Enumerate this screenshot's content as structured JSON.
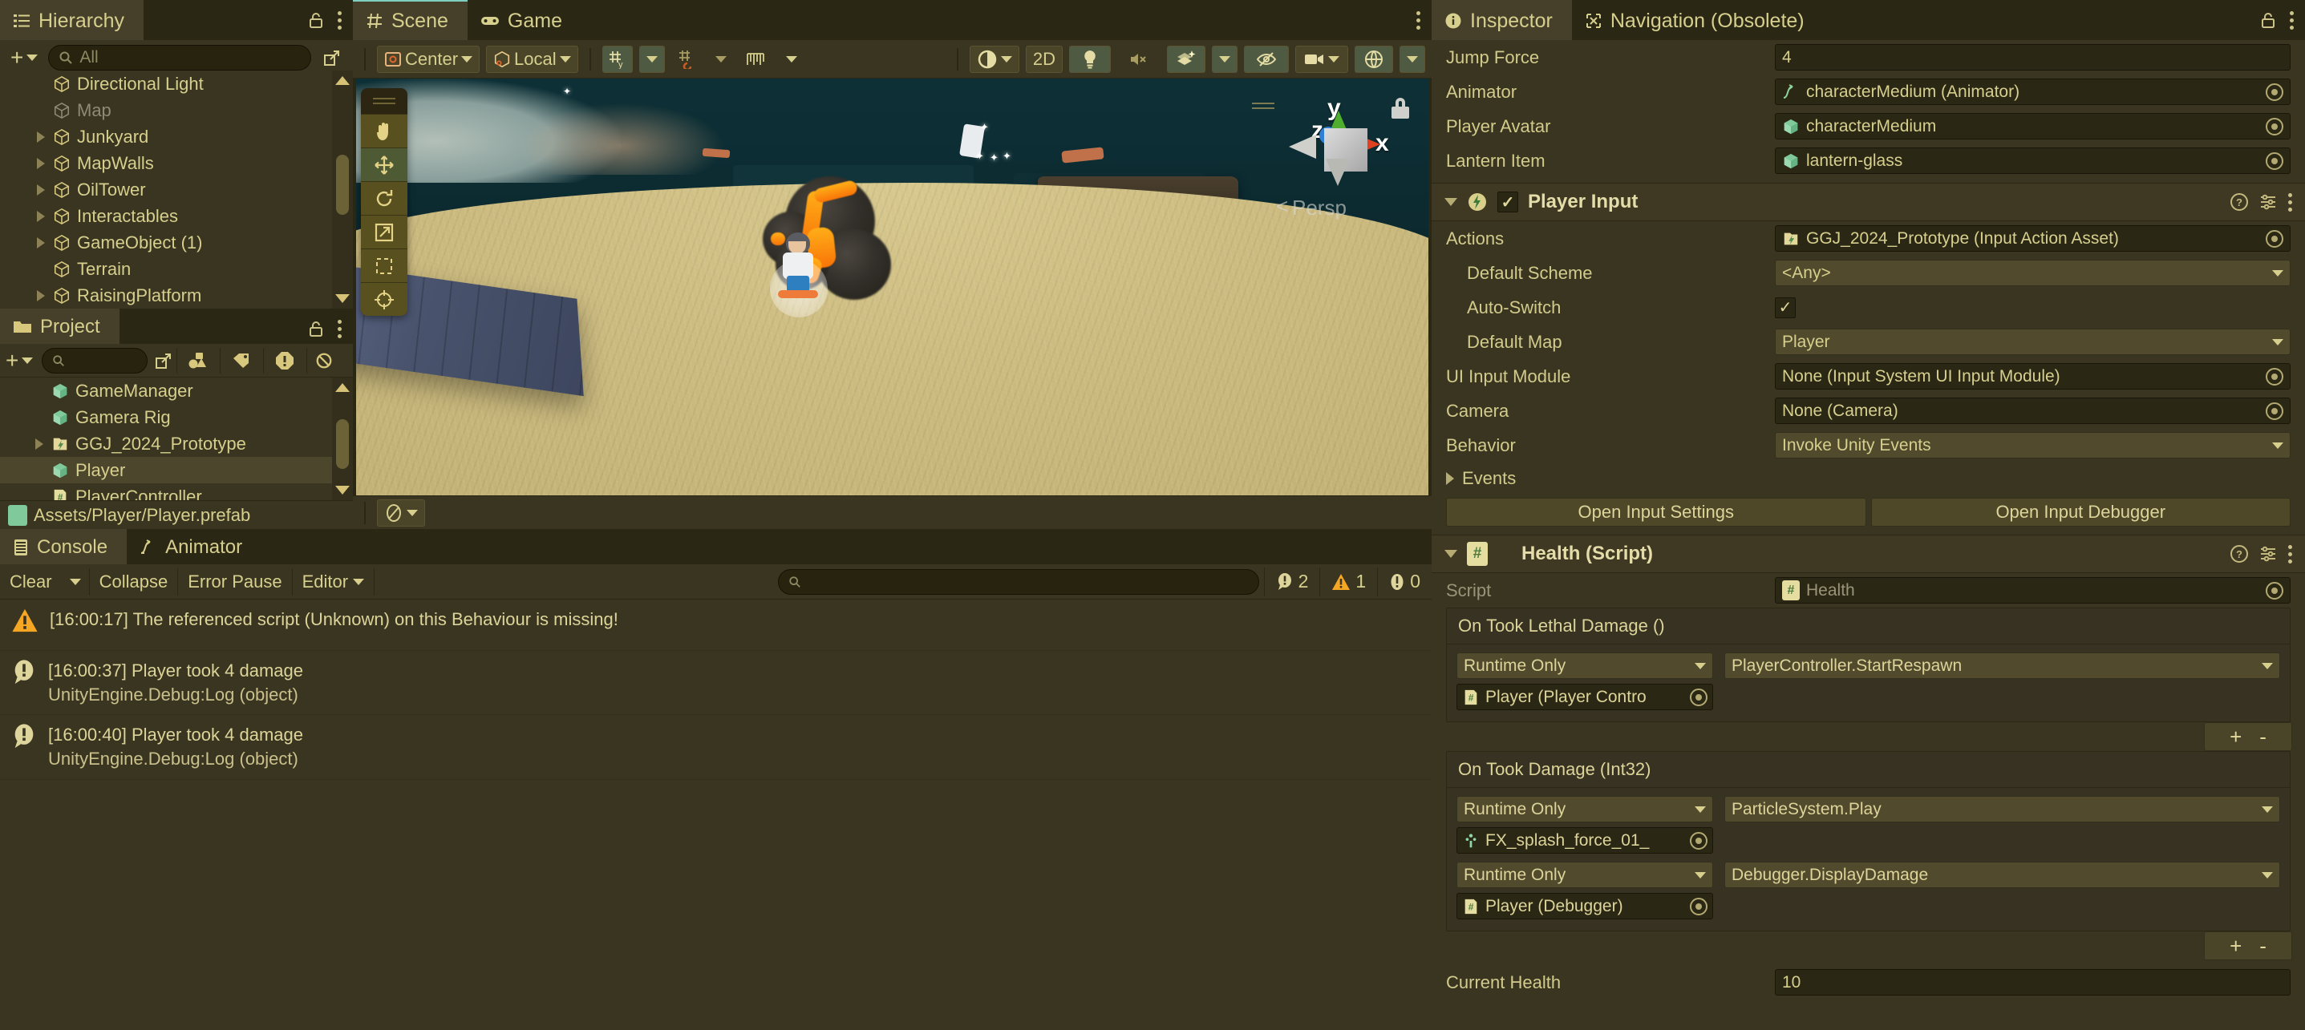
{
  "hierarchy": {
    "tab_label": "Hierarchy",
    "tab_icon": "hierarchy-icon",
    "add_label": "+",
    "search_placeholder": "All",
    "items": [
      {
        "label": "Directional Light",
        "indent": 1,
        "expandable": false,
        "dim": false
      },
      {
        "label": "Map",
        "indent": 1,
        "expandable": false,
        "dim": true
      },
      {
        "label": "Junkyard",
        "indent": 1,
        "expandable": true,
        "dim": false
      },
      {
        "label": "MapWalls",
        "indent": 1,
        "expandable": true,
        "dim": false
      },
      {
        "label": "OilTower",
        "indent": 1,
        "expandable": true,
        "dim": false
      },
      {
        "label": "Interactables",
        "indent": 1,
        "expandable": true,
        "dim": false
      },
      {
        "label": "GameObject (1)",
        "indent": 1,
        "expandable": true,
        "dim": false
      },
      {
        "label": "Terrain",
        "indent": 1,
        "expandable": false,
        "dim": false
      },
      {
        "label": "RaisingPlatform",
        "indent": 1,
        "expandable": true,
        "dim": false
      }
    ]
  },
  "project": {
    "tab_label": "Project",
    "tab_icon": "folder-icon",
    "search_placeholder": "",
    "toolbar_icons": [
      "shapes-icon",
      "tag-icon",
      "warning-octagon-icon",
      "no-sign-icon"
    ],
    "items": [
      {
        "label": "GameManager",
        "icon": "prefab-cube",
        "expandable": false,
        "selected": false
      },
      {
        "label": "Gamera Rig",
        "icon": "prefab-cube",
        "expandable": false,
        "selected": false
      },
      {
        "label": "GGJ_2024_Prototype",
        "icon": "input-asset",
        "expandable": true,
        "selected": false
      },
      {
        "label": "Player",
        "icon": "prefab-cube",
        "expandable": false,
        "selected": true
      },
      {
        "label": "PlayerController",
        "icon": "script-file",
        "expandable": false,
        "selected": false
      }
    ],
    "footer_path": "Assets/Player/Player.prefab"
  },
  "scene": {
    "tabs": [
      {
        "label": "Scene",
        "icon": "grid-icon",
        "active": true
      },
      {
        "label": "Game",
        "icon": "gamepad-icon",
        "active": false
      }
    ],
    "toolbar": {
      "pivot_label": "Center",
      "pivot_icon": "pivot-center-icon",
      "space_label": "Local",
      "space_icon": "local-space-icon",
      "grid_snap_icon": "grid-axis-y-icon",
      "snap_increment_icon": "grid-snap-icon",
      "ruler_icon": "ruler-icon",
      "shading_icon": "shaded-sphere-icon",
      "mode_2d_label": "2D",
      "lighting_icon": "lightbulb-icon",
      "audio_icon": "audio-mute-icon",
      "effects_icon": "fx-sparkle-icon",
      "hidden_icon": "eye-hidden-icon",
      "camera_icon": "camera-icon",
      "gizmos_icon": "gizmos-globe-icon"
    },
    "tools": [
      {
        "name": "hand-tool-icon",
        "active": false
      },
      {
        "name": "move-tool-icon",
        "active": true
      },
      {
        "name": "rotate-tool-icon",
        "active": false
      },
      {
        "name": "scale-tool-icon",
        "active": false
      },
      {
        "name": "rect-tool-icon",
        "active": false
      },
      {
        "name": "transform-tool-icon",
        "active": false
      }
    ],
    "gizmo": {
      "axis_x": "x",
      "axis_y": "y",
      "axis_z": "z",
      "perspective_label": "Persp"
    },
    "bottom_tool_icon": "no-effects-icon"
  },
  "console": {
    "tabs": [
      {
        "label": "Console",
        "icon": "console-icon",
        "active": true
      },
      {
        "label": "Animator",
        "icon": "animator-icon",
        "active": false
      }
    ],
    "toolbar": {
      "clear_label": "Clear",
      "collapse_label": "Collapse",
      "error_pause_label": "Error Pause",
      "editor_label": "Editor",
      "search_placeholder": ""
    },
    "counts": {
      "log": "2",
      "warning": "1",
      "error": "0"
    },
    "logs": [
      {
        "type": "warning",
        "message": "[16:00:17] The referenced script (Unknown) on this Behaviour is missing!",
        "detail": ""
      },
      {
        "type": "info",
        "message": "[16:00:37] Player took 4 damage",
        "detail": "UnityEngine.Debug:Log (object)"
      },
      {
        "type": "info",
        "message": "[16:00:40] Player took 4 damage",
        "detail": "UnityEngine.Debug:Log (object)"
      }
    ]
  },
  "inspector": {
    "tabs": [
      {
        "label": "Inspector",
        "icon": "info-icon",
        "active": true
      },
      {
        "label": "Navigation (Obsolete)",
        "icon": "navigation-icon",
        "active": false
      }
    ],
    "top_fields": [
      {
        "label": "Jump Force",
        "value": "4",
        "kind": "text",
        "icon": ""
      },
      {
        "label": "Animator",
        "value": "characterMedium (Animator)",
        "kind": "object",
        "icon": "animator-icon"
      },
      {
        "label": "Player Avatar",
        "value": "characterMedium",
        "kind": "object",
        "icon": "prefab-cube"
      },
      {
        "label": "Lantern Item",
        "value": "lantern-glass",
        "kind": "object",
        "icon": "prefab-cube"
      }
    ],
    "player_input": {
      "title": "Player Input",
      "icon": "input-component-icon",
      "enabled": true,
      "fields": [
        {
          "label": "Actions",
          "value": "GGJ_2024_Prototype (Input Action Asset)",
          "kind": "object",
          "indent": 0,
          "icon": "input-asset"
        },
        {
          "label": "Default Scheme",
          "value": "<Any>",
          "kind": "dropdown",
          "indent": 1
        },
        {
          "label": "Auto-Switch",
          "value": "",
          "kind": "checkbox",
          "indent": 1,
          "checked": true
        },
        {
          "label": "Default Map",
          "value": "Player",
          "kind": "dropdown",
          "indent": 1
        },
        {
          "label": "UI Input Module",
          "value": "None (Input System UI Input Module)",
          "kind": "object",
          "indent": 0,
          "icon": ""
        },
        {
          "label": "Camera",
          "value": "None (Camera)",
          "kind": "object",
          "indent": 0,
          "icon": ""
        },
        {
          "label": "Behavior",
          "value": "Invoke Unity Events",
          "kind": "dropdown",
          "indent": 0
        }
      ],
      "events_label": "Events",
      "buttons": [
        {
          "label": "Open Input Settings"
        },
        {
          "label": "Open Input Debugger"
        }
      ]
    },
    "health": {
      "title": "Health (Script)",
      "icon": "script-file",
      "script_label": "Script",
      "script_value": "Health",
      "events": [
        {
          "title": "On Took Lethal Damage ()",
          "entries": [
            {
              "mode": "Runtime Only",
              "method": "PlayerController.StartRespawn",
              "object": "Player (Player Contro",
              "object_icon": "script-file"
            }
          ]
        },
        {
          "title": "On Took Damage (Int32)",
          "entries": [
            {
              "mode": "Runtime Only",
              "method": "ParticleSystem.Play",
              "object": "FX_splash_force_01_",
              "object_icon": "particle-icon"
            },
            {
              "mode": "Runtime Only",
              "method": "Debugger.DisplayDamage",
              "object": "Player (Debugger)",
              "object_icon": "script-file"
            }
          ]
        }
      ],
      "add_label": "+",
      "remove_label": "-",
      "current_health_label": "Current Health",
      "current_health_value": "10"
    }
  },
  "colors": {
    "panel_bg": "#3a3520",
    "window_bg": "#2b2715",
    "text": "#d6cf8e",
    "accent_tab": "#7ecfc2",
    "warning": "#f5a623",
    "field_bg": "#2b2715"
  }
}
